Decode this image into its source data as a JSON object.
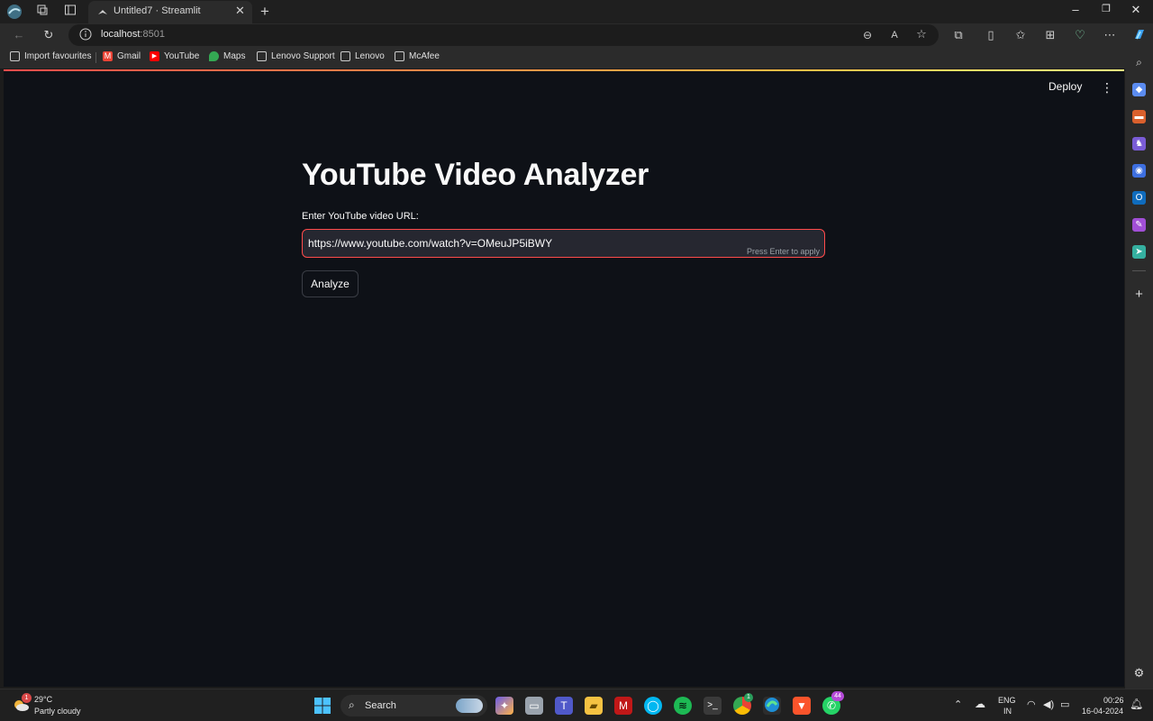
{
  "browser": {
    "tab_title": "Untitled7 · Streamlit",
    "url_host": "localhost",
    "url_port": ":8501",
    "bookmarks": [
      {
        "label": "Import favourites",
        "icon": "import-icon"
      },
      {
        "label": "Gmail",
        "icon": "gmail-icon",
        "color": "#ea4335"
      },
      {
        "label": "YouTube",
        "icon": "youtube-icon",
        "color": "#ff0000"
      },
      {
        "label": "Maps",
        "icon": "maps-icon",
        "color": "#34a853"
      },
      {
        "label": "Lenovo Support",
        "icon": "page-icon"
      },
      {
        "label": "Lenovo",
        "icon": "page-icon"
      },
      {
        "label": "McAfee",
        "icon": "page-icon"
      }
    ]
  },
  "app": {
    "deploy_label": "Deploy",
    "title": "YouTube Video Analyzer",
    "input_label": "Enter YouTube video URL:",
    "input_value": "https://www.youtube.com/watch?v=OMeuJP5iBWY",
    "enter_hint": "Press Enter to apply",
    "analyze_label": "Analyze",
    "accent_color": "#ff4b4b"
  },
  "taskbar": {
    "weather_temp": "29°C",
    "weather_desc": "Partly cloudy",
    "weather_badge": "1",
    "search_label": "Search",
    "spotify_badge": "",
    "chrome_badge": "1",
    "whatsapp_badge": "44",
    "lang_top": "ENG",
    "lang_bottom": "IN",
    "time": "00:26",
    "date": "16-04-2024"
  }
}
